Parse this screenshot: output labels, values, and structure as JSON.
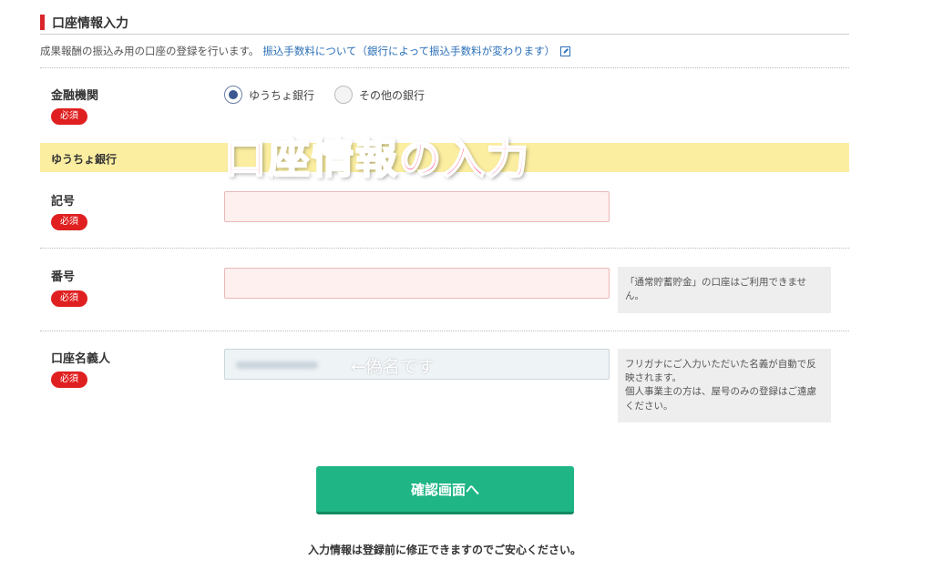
{
  "section": {
    "title": "口座情報入力"
  },
  "intro": {
    "text": "成果報酬の振込み用の口座の登録を行います。",
    "link": "振込手数料について（銀行によって振込手数料が変わります）"
  },
  "required_label": "必須",
  "bank": {
    "label": "金融機関",
    "options": [
      {
        "label": "ゆうちょ銀行",
        "checked": true
      },
      {
        "label": "その他の銀行",
        "checked": false
      }
    ]
  },
  "band": {
    "label": "ゆうちょ銀行"
  },
  "overlay": {
    "text": "口座情報の入力",
    "color": "#ff4d8a"
  },
  "fields": {
    "kigou": {
      "label": "記号",
      "value": ""
    },
    "bangou": {
      "label": "番号",
      "value": "",
      "hint": "「通常貯蓄貯金」の口座はご利用できません。"
    },
    "meigi": {
      "label": "口座名義人",
      "annotation": "←偽名です",
      "hint": "フリガナにご入力いただいた名義が自動で反映されます。\n個人事業主の方は、屋号のみの登録はご遠慮ください。"
    }
  },
  "confirm": {
    "label": "確認画面へ"
  },
  "footer": {
    "note": "入力情報は登録前に修正できますのでご安心ください。"
  },
  "colors": {
    "accent_red": "#e02020",
    "button_green": "#1fb585",
    "link_blue": "#2a6fb7",
    "band_yellow": "#fbeea0"
  }
}
